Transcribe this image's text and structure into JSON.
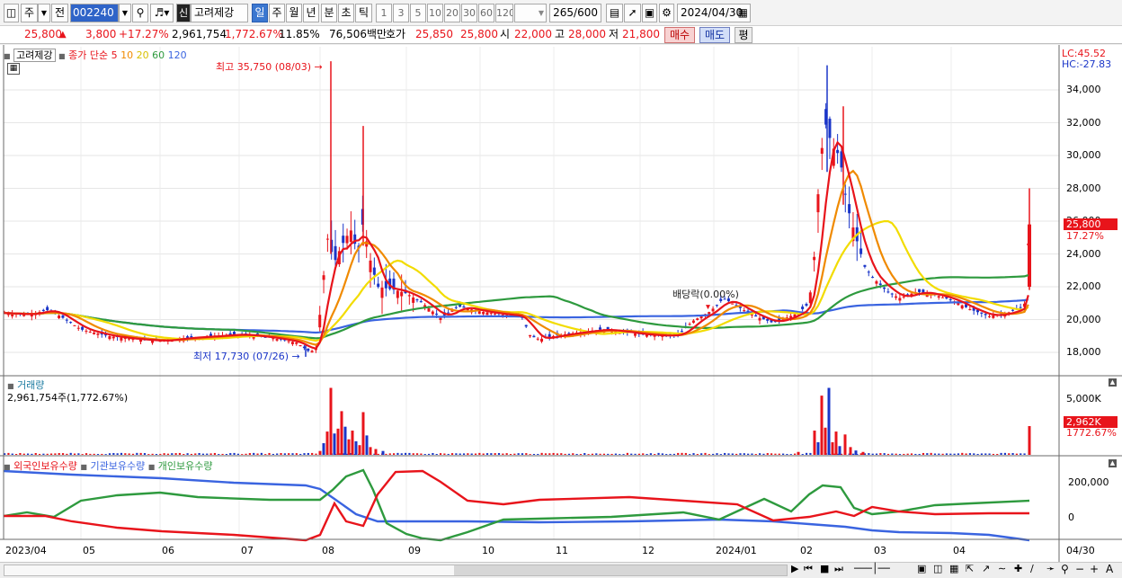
{
  "toolbar": {
    "market_type": "주",
    "prev_label": "전",
    "stock_code": "002240",
    "credit_badge": "신",
    "stock_name": "고려제강",
    "periods": [
      "일",
      "주",
      "월",
      "년",
      "분",
      "초",
      "틱"
    ],
    "selected_period": "일",
    "intervals": [
      "1",
      "3",
      "5",
      "10",
      "20",
      "30",
      "60",
      "120"
    ],
    "count": "265",
    "count_total": "/600",
    "date": "2024/04/30"
  },
  "quote": {
    "price": "25,800",
    "change": "3,800",
    "change_pct": "+17.27%",
    "volume": "2,961,754",
    "volume_ratio": "1,772.67%",
    "turnover": "11.85%",
    "amount": "76,506백만",
    "bid_label": "호가",
    "ask": "25,850",
    "bid": "25,800",
    "open_label": "시",
    "open": "22,000",
    "high_label": "고",
    "high": "28,000",
    "low_label": "저",
    "low": "21,800",
    "buy_button": "매수",
    "sell_button": "매도",
    "eval_button": "평"
  },
  "price_panel": {
    "stock_label": "고려제강",
    "legend_prefix": "종가 단순",
    "ma_labels": [
      "5",
      "10",
      "20",
      "60",
      "120"
    ],
    "ma_colors": [
      "#e8141b",
      "#f08a00",
      "#f2dc00",
      "#2e9a3e",
      "#3a64e0"
    ],
    "lc": "LC:45.52",
    "hc": "HC:-27.83",
    "high_annot": "최고 35,750 (08/03)",
    "low_annot": "최저 17,730 (07/26)",
    "dividend_annot": "배당락(0.00%)",
    "current_price_tag": "25,800",
    "current_pct_tag": "17.27%",
    "y_ticks": [
      "34,000",
      "32,000",
      "30,000",
      "28,000",
      "26,000",
      "24,000",
      "22,000",
      "20,000",
      "18,000"
    ]
  },
  "volume_panel": {
    "title": "거래량",
    "value": "2,961,754주(1,772.67%)",
    "y_tick": "5,000K",
    "tag_value": "2,962K",
    "tag_pct": "1772.67%"
  },
  "holdings_panel": {
    "legend": [
      "외국인보유수량",
      "기관보유수량",
      "개인보유수량"
    ],
    "colors": [
      "#e8141b",
      "#3a64e0",
      "#2e9a3e"
    ],
    "y_ticks": [
      "200,000",
      "0"
    ]
  },
  "x_axis": {
    "labels": [
      "2023/04",
      "05",
      "06",
      "07",
      "08",
      "09",
      "10",
      "11",
      "12",
      "2024/01",
      "02",
      "03",
      "04"
    ],
    "end_label": "04/30"
  }
}
